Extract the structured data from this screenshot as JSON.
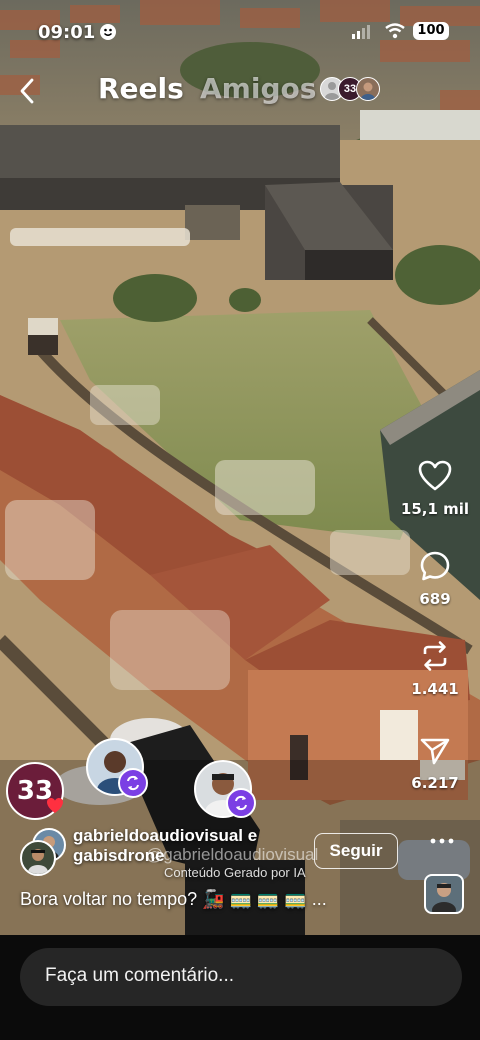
{
  "status_bar": {
    "time": "09:01",
    "battery": "100"
  },
  "header": {
    "reels_label": "Reels",
    "friends_label": "Amigos",
    "friend_badge": "33"
  },
  "actions": {
    "likes": "15,1 mil",
    "comments": "689",
    "reposts": "1.441",
    "shares": "6.217"
  },
  "creators": {
    "line1": "gabrieldoaudiovisual e",
    "line2": "gabisdrone",
    "follow_label": "Seguir",
    "ai_label": "Conteúdo Gerado por IA",
    "watermark": "@gabrieldoaudiovisual",
    "jersey_number": "33"
  },
  "caption": {
    "text": "Bora voltar no tempo? 🚂 🚃 🚃 🚃 ..."
  },
  "comment": {
    "placeholder": "Faça um comentário..."
  },
  "colors": {
    "background": "#000000",
    "input_bg": "#262626",
    "badge_purple": "#7b3fe4",
    "like_dot": "#ff3040"
  }
}
